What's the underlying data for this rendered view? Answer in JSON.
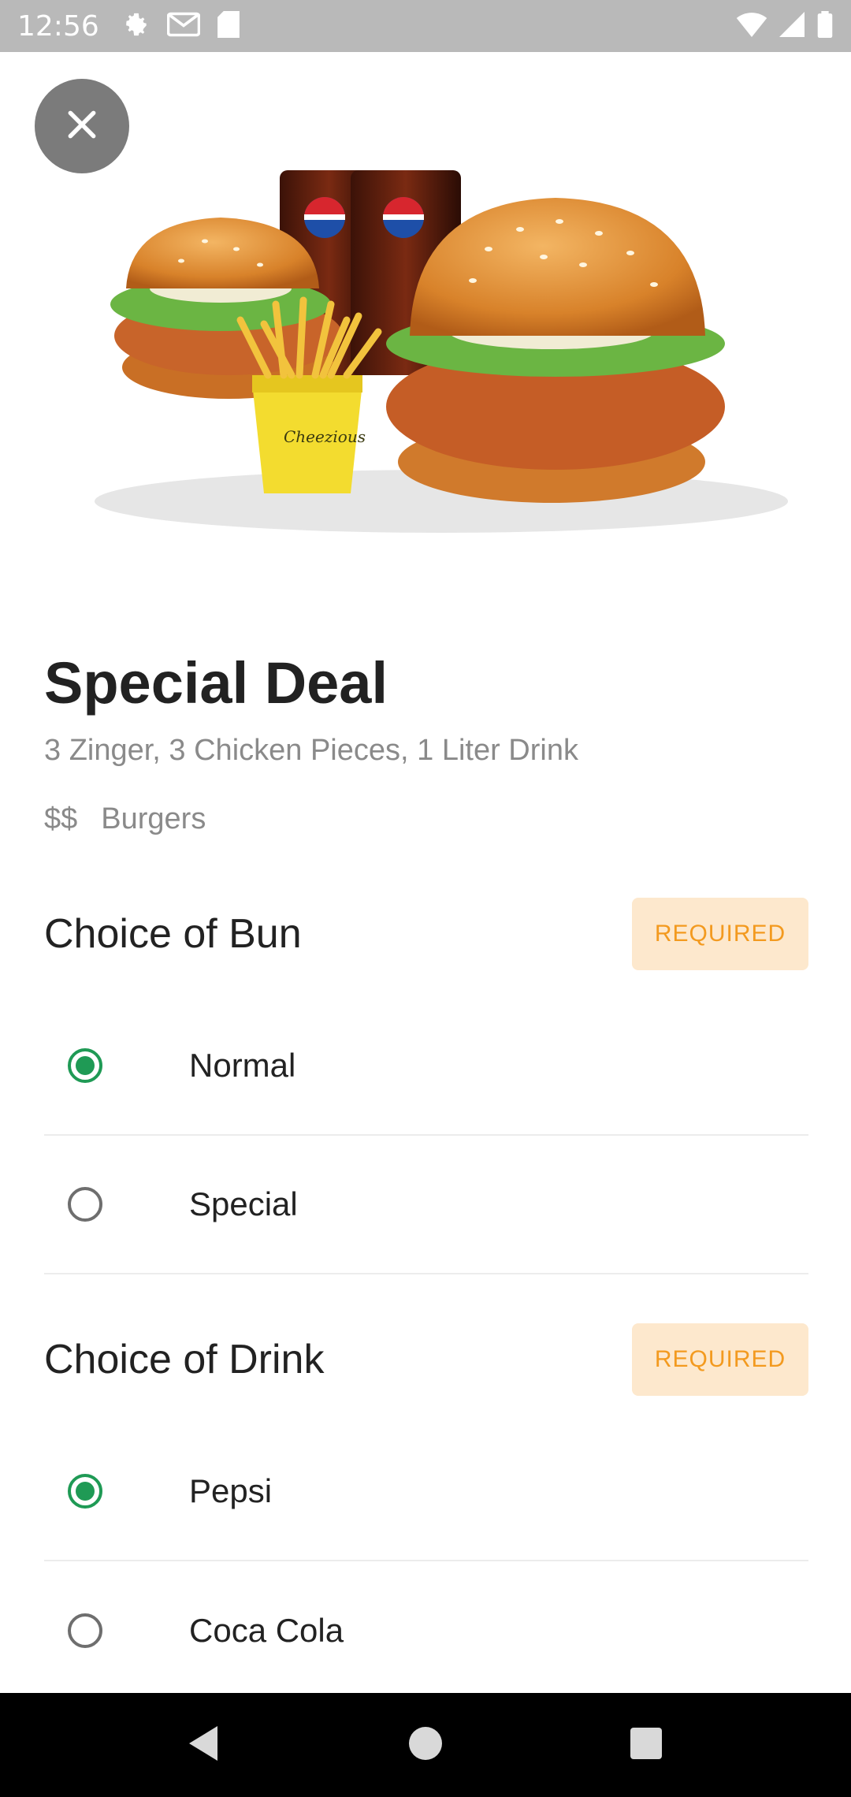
{
  "status_bar": {
    "time": "12:56",
    "left_icons": [
      "gear-icon",
      "gmail-icon",
      "sd-card-icon"
    ],
    "right_icons": [
      "wifi-icon",
      "signal-icon",
      "battery-icon"
    ]
  },
  "hero": {
    "image": "burger-meal-image"
  },
  "item": {
    "title": "Special Deal",
    "description": "3 Zinger, 3 Chicken Pieces, 1 Liter Drink",
    "price_level": "$$",
    "category": "Burgers"
  },
  "sections": [
    {
      "title": "Choice of Bun",
      "badge": "REQUIRED",
      "options": [
        {
          "label": "Normal",
          "selected": true
        },
        {
          "label": "Special",
          "selected": false
        }
      ]
    },
    {
      "title": "Choice of Drink",
      "badge": "REQUIRED",
      "options": [
        {
          "label": "Pepsi",
          "selected": true
        },
        {
          "label": "Coca Cola",
          "selected": false
        }
      ]
    }
  ],
  "colors": {
    "accent_green": "#1f9a55",
    "badge_bg": "#fde8cd",
    "badge_text": "#f39a1f",
    "status_bar": "#b9b9b9"
  },
  "nav_bar": [
    "back-icon",
    "home-icon",
    "recents-icon"
  ]
}
